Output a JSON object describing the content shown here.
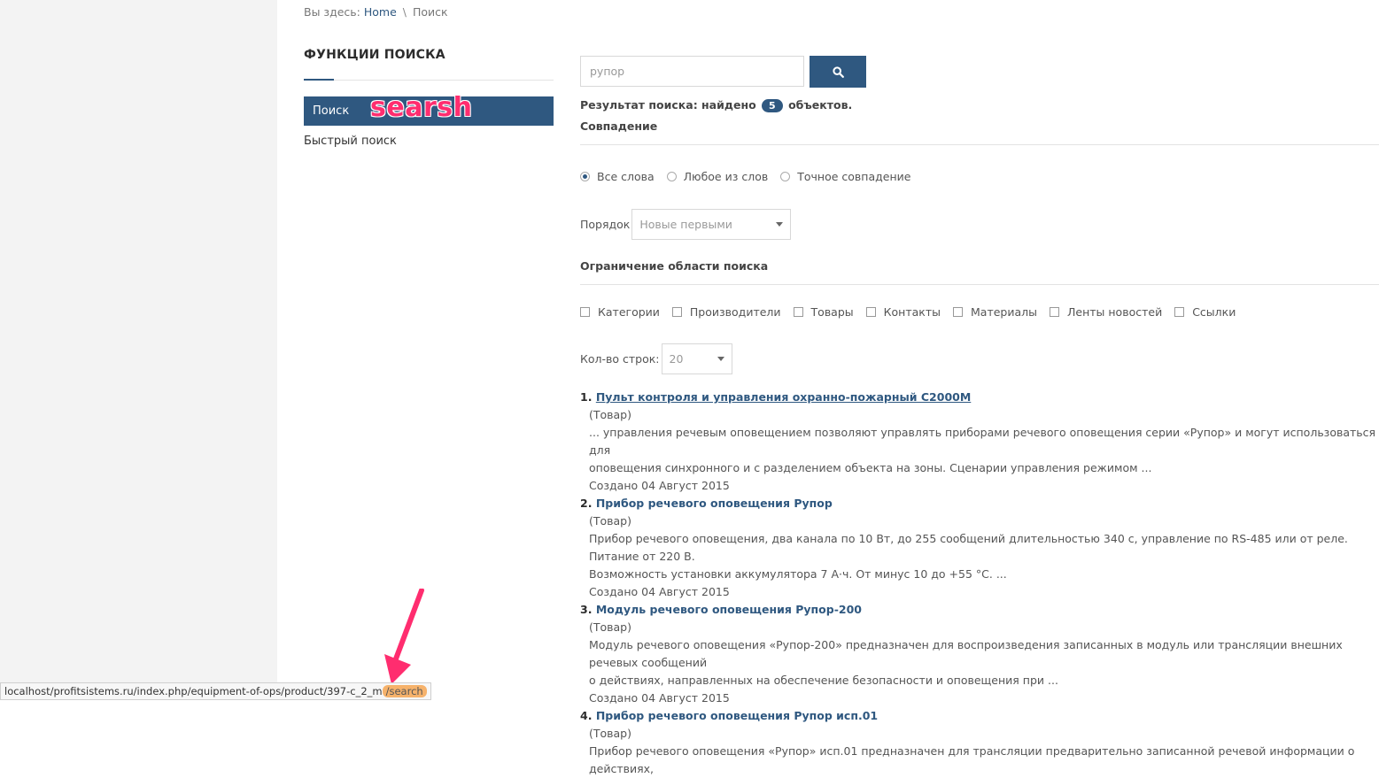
{
  "breadcrumb": {
    "prefix": "Вы здесь:",
    "home": "Home",
    "sep": "\\",
    "current": "Поиск"
  },
  "sidebar": {
    "title": "ФУНКЦИИ ПОИСКА",
    "items": [
      {
        "label": "Поиск",
        "active": true
      },
      {
        "label": "Быстрый поиск",
        "active": false
      }
    ]
  },
  "annotation": {
    "text": "searsh",
    "color": "#ff2d6f"
  },
  "search": {
    "value": "рупор",
    "button_icon": "search-icon"
  },
  "result_summary": {
    "prefix": "Результат поиска: найдено",
    "count": "5",
    "suffix": "объектов."
  },
  "match": {
    "label": "Совпадение",
    "options": [
      {
        "label": "Все слова",
        "checked": true
      },
      {
        "label": "Любое из слов",
        "checked": false
      },
      {
        "label": "Точное совпадение",
        "checked": false
      }
    ]
  },
  "order": {
    "label": "Порядок",
    "selected": "Новые первыми"
  },
  "scope": {
    "label": "Ограничение области поиска",
    "options": [
      "Категории",
      "Производители",
      "Товары",
      "Контакты",
      "Материалы",
      "Ленты новостей",
      "Ссылки"
    ]
  },
  "rows": {
    "label": "Кол-во строк:",
    "selected": "20"
  },
  "results": [
    {
      "num": "1.",
      "title": "Пульт контроля и управления охранно-пожарный С2000М",
      "type": "(Товар)",
      "text1": "... управления речевым оповещением позволяют управлять приборами речевого оповещения серии «Рупор» и могут использоваться для",
      "text2": "оповещения синхронного и с разделением объекта на зоны. Сценарии управления режимом ...",
      "created": "Создано 04 Август 2015"
    },
    {
      "num": "2.",
      "title": "Прибор речевого оповещения Рупор",
      "type": "(Товар)",
      "text1": "Прибор речевого оповещения, два канала по 10 Вт, до 255 сообщений длительностью 340 с, управление по RS-485 или от реле. Питание от 220 В.",
      "text2": "Возможность установки аккумулятора 7 А·ч. От минус 10 до +55 °С. ...",
      "created": "Создано 04 Август 2015"
    },
    {
      "num": "3.",
      "title": "Модуль речевого оповещения Рупор-200",
      "type": "(Товар)",
      "text1": "Модуль речевого оповещения «Рупор-200» предназначен для воспроизведения записанных в модуль или трансляции внешних речевых сообщений",
      "text2": "о действиях, направленных на обеспечение безопасности и оповещения при ...",
      "created": "Создано 04 Август 2015"
    },
    {
      "num": "4.",
      "title": "Прибор речевого оповещения Рупор исп.01",
      "type": "(Товар)",
      "text1": "Прибор речевого оповещения «Рупор» исп.01 предназначен для трансляции предварительно записанной речевой информации о действиях,"
    }
  ],
  "status_bar": {
    "url": "localhost/profitsistems.ru/index.php/equipment-of-ops/product/397-c_2_m",
    "highlight": "/search"
  },
  "colors": {
    "accent": "#2f5880",
    "annotation": "#ff2d6f",
    "highlight": "#f6b26b"
  }
}
